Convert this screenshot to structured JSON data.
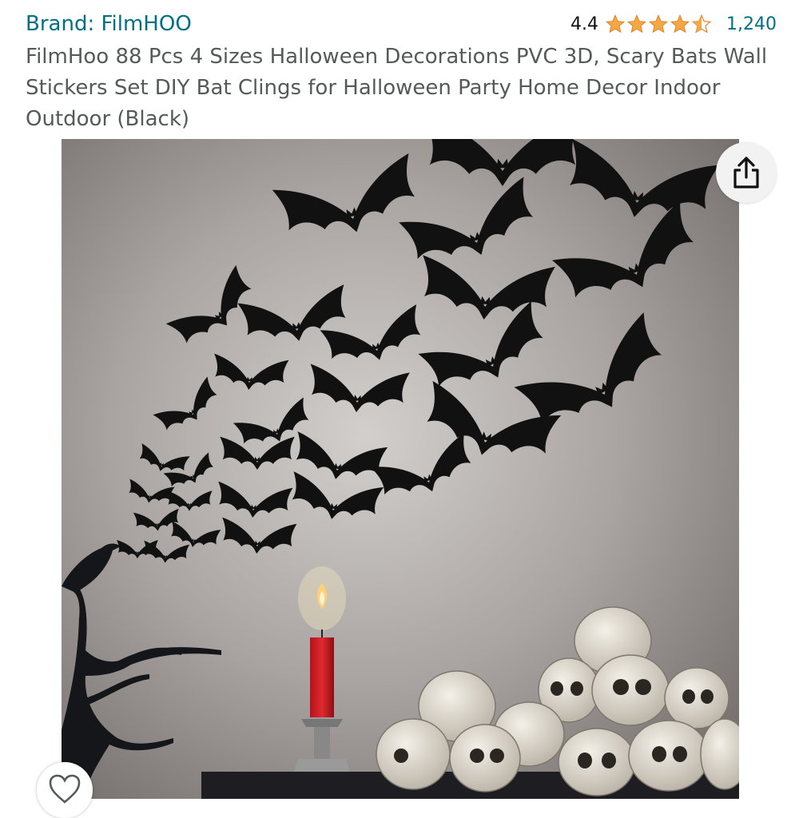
{
  "brand": {
    "label": "Brand: FilmHOO"
  },
  "rating": {
    "value": "4.4",
    "stars": 4.4,
    "count": "1,240",
    "star_color": "#f3a847"
  },
  "product": {
    "title": "FilmHoo 88 Pcs 4 Sizes Halloween Decorations PVC 3D, Scary Bats Wall Stickers Set DIY Bat Clings for Halloween Party Home Decor Indoor Outdoor (Black)"
  },
  "actions": {
    "share_icon": "share-icon",
    "wishlist_icon": "heart-outline-icon"
  },
  "colors": {
    "link": "#007185",
    "title_text": "#565959"
  }
}
